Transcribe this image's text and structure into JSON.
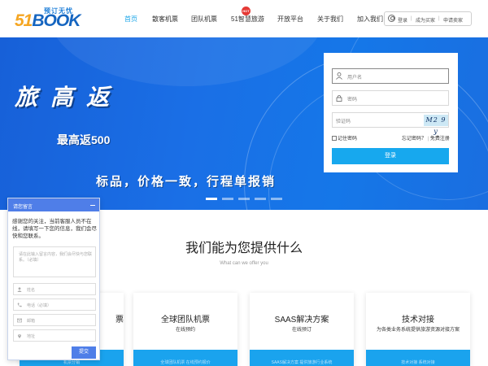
{
  "logo": {
    "tagline": "预订无忧",
    "brand_a": "51",
    "brand_b": "BOOK"
  },
  "nav": {
    "items": [
      "首页",
      "散客机票",
      "团队机票",
      "51智慧旅游",
      "开放平台",
      "关于我们",
      "加入我们"
    ],
    "hot_badge": "HOT"
  },
  "account": {
    "login": "登录",
    "buyer": "成为买家",
    "seller": "申请卖家"
  },
  "banner": {
    "title": "旅高返",
    "subtitle": "最高返500",
    "slogan": "标品，价格一致，行程单报销"
  },
  "login_form": {
    "username_placeholder": "用户名",
    "password_placeholder": "密码",
    "captcha_placeholder": "验证码",
    "captcha_text": "M2 9 y",
    "remember_label": "记住密码",
    "forgot_link": "忘记密码？",
    "register_link": "免费注册",
    "submit_label": "登录"
  },
  "services": {
    "title": "我们能为您提供什么",
    "subtitle": "What can we offer you",
    "cards": [
      {
        "title": "票",
        "desc": "",
        "bar": "机票分销"
      },
      {
        "title": "全球团队机票",
        "desc": "在线预约",
        "bar": "全球团队机票 在线预约报价"
      },
      {
        "title": "SAAS解决方案",
        "desc": "在线预订",
        "bar": "SAAS解决方案 提供旅游行业系统"
      },
      {
        "title": "技术对接",
        "desc": "为各类业务系统提供旅游资源对接方案",
        "bar": "技术对接 系统对接"
      }
    ]
  },
  "chat": {
    "header": "请您留言",
    "message": "感谢您的关注，当前客服人员不在线，请填写一下您的信息，我们会尽快和您联系。",
    "textarea_placeholder": "请在此输入留言内容，我们会尽快与您联系。（必填）",
    "name_placeholder": "姓名",
    "phone_placeholder": "电话（必填）",
    "email_placeholder": "邮箱",
    "address_placeholder": "地址",
    "send_label": "提交"
  },
  "colors": {
    "accent": "#17a8ee",
    "banner": "#1a6fe6",
    "chat": "#4f7ee8"
  }
}
